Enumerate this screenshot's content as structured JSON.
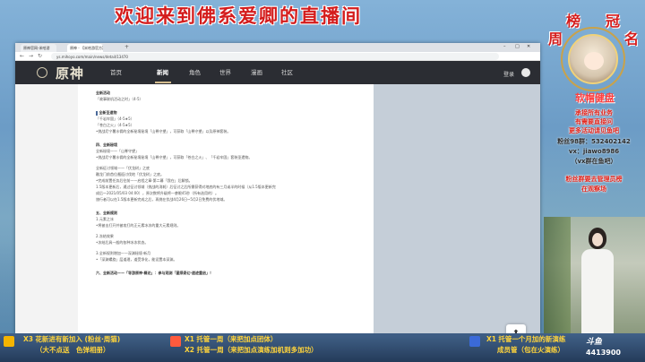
{
  "stream": {
    "title": "欢迎来到佛系爱卿的直播间"
  },
  "browser": {
    "tabs": [
      "原神官网-米哈游",
      "原神 - 【米哈游官方】原神"
    ],
    "new_tab": "+",
    "window_controls": [
      "–",
      "□",
      "✕"
    ],
    "nav_buttons": [
      "←",
      "→",
      "↻"
    ],
    "url": "ys.mihoyo.com/main/news/detail/13470"
  },
  "site": {
    "logo": "原神",
    "nav": [
      "首页",
      "新闻",
      "角色",
      "世界",
      "漫画",
      "社区"
    ],
    "active_nav": "新闻",
    "login": "登录"
  },
  "article": {
    "lines": [
      {
        "t": "全新活动",
        "s": "h"
      },
      {
        "t": "「故事联机活动之时」（4-5）",
        "s": "n"
      },
      {
        "t": "",
        "s": "gap"
      },
      {
        "t": "全新圣遗物",
        "s": "sec"
      },
      {
        "t": "「千岩牢固」（4-5★5）",
        "s": "n"
      },
      {
        "t": "「苍白之火」（4-5★5）",
        "s": "n"
      },
      {
        "t": "•挑战尼宁薯水佣的全新秘境秘境「山脊守望」，可获取「山脊守望」以及原神套装。",
        "s": "n"
      },
      {
        "t": "",
        "s": "gap"
      },
      {
        "t": "四、全新秘境",
        "s": "h"
      },
      {
        "t": "全新秘境——「山脊守望」",
        "s": "n"
      },
      {
        "t": "•挑战尼宁薯水佣的全新秘境秘境「山脊守望」，可获取「苍白之火」、「千岩牢固」套装圣遗物。",
        "s": "n"
      },
      {
        "t": "",
        "s": "gap"
      },
      {
        "t": "全新征讨领域——「伏龙树」之底",
        "s": "n"
      },
      {
        "t": "雕龙门前首位邂逅讨伐地「伏龙树」之底。",
        "s": "n"
      },
      {
        "t": "•完成前置任务后往前——启程之章·第二幕「我在」后解锁。",
        "s": "n"
      },
      {
        "t": "1.5版本更新后，通过征讨领域（挑战的消耗）后征讨之后所需获得对地底的有三月或半的时候（从1.5版本更新完",
        "s": "n"
      },
      {
        "t": "成后～2021/05/03 04:00），原次数将升级将一袭眼45秒（所有选用的）。",
        "s": "n"
      },
      {
        "t": "旅行者可以在1.5版本更新完成之后，再挑在伏战4月26日~5月2日免费的伏地域。",
        "s": "n"
      },
      {
        "t": "",
        "s": "gap"
      },
      {
        "t": "五、全新规则",
        "s": "h"
      },
      {
        "t": "1.元素之冰",
        "s": "n"
      },
      {
        "t": "•将被击打开并被攻打的正元素冰冻的重大元素规则。",
        "s": "n"
      },
      {
        "t": "",
        "s": "gap"
      },
      {
        "t": "2.冻结效果",
        "s": "n"
      },
      {
        "t": "•冻结后具一般的各种冰冻状态。",
        "s": "n"
      },
      {
        "t": "",
        "s": "gap"
      },
      {
        "t": "3.全新规则增加——深渊秘境·新月",
        "s": "n"
      },
      {
        "t": "•「深渊螺旋」层道理，道受净化，能设置本深渊。",
        "s": "n"
      },
      {
        "t": "",
        "s": "gap"
      },
      {
        "t": "六、全新活动——「导游原神·概论」：参与观测「星陨奇幻·遗迹重启」！",
        "s": "h"
      }
    ]
  },
  "panel": {
    "rank_chars": [
      "榜",
      "冠",
      "周",
      "名"
    ],
    "name": "软帽健盘",
    "info": [
      "承接所有业务",
      "有需要直接问",
      "更多活动请见鱼吧",
      "粉丝98群：532402142",
      "vx：jiawo8986",
      "（vx群在鱼吧）",
      "粉丝群要去管理员榜",
      "在观察场"
    ]
  },
  "gifts": [
    {
      "count": "X3",
      "line1": "花新进有新加入 (粉丝·周猫)",
      "line2": "（大不点送　色弹相册）",
      "icon_color": "#f5b400"
    },
    {
      "count": "X1",
      "line1": "托管一周（来把加点团体）",
      "line2": "X2 托管一周（来把加点演练加机则多加功）",
      "icon_color": "#ff5a3d"
    },
    {
      "count": "X1",
      "line1": "托管一个月加的新演练",
      "line2": "成员管（包在火演练）",
      "icon_color": "#3b6ad9"
    }
  ],
  "platform": {
    "name": "斗鱼",
    "fans": "4413900"
  }
}
